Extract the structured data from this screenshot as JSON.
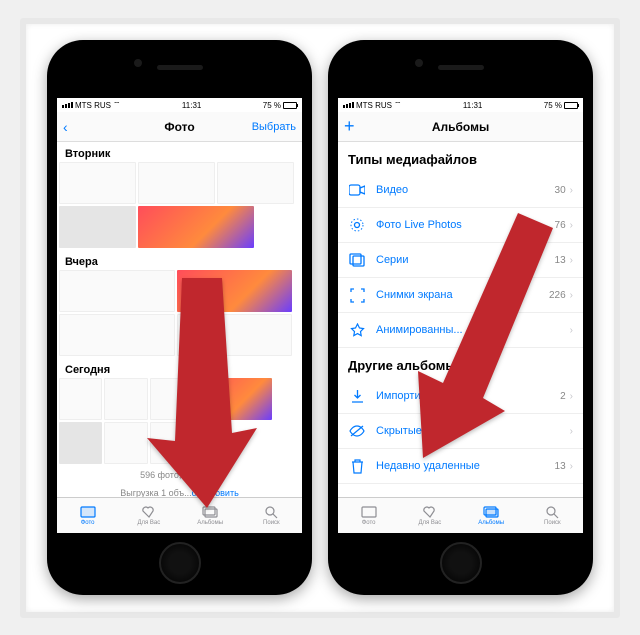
{
  "status": {
    "carrier": "MTS RUS",
    "time": "11:31",
    "battery": "75 %"
  },
  "left": {
    "title": "Фото",
    "select": "Выбрать",
    "sections": [
      "Вторник",
      "Вчера",
      "Сегодня"
    ],
    "summary": "596 фото, ... видео",
    "upload": {
      "prefix": "Выгрузка 1 объ...",
      "action": "остановить"
    },
    "tabs": [
      "Фото",
      "Для Вас",
      "Альбомы",
      "Поиск"
    ],
    "active_tab": 0
  },
  "right": {
    "title": "Альбомы",
    "section_media": "Типы медиафайлов",
    "media": [
      {
        "icon": "video",
        "label": "Видео",
        "count": "30"
      },
      {
        "icon": "live",
        "label": "Фото Live Photos",
        "count": "76"
      },
      {
        "icon": "burst",
        "label": "Серии",
        "count": "13"
      },
      {
        "icon": "screenshot",
        "label": "Снимки экрана",
        "count": "226"
      },
      {
        "icon": "animated",
        "label": "Анимированны...",
        "count": ""
      }
    ],
    "section_other": "Другие альбомы",
    "other": [
      {
        "icon": "import",
        "label": "Импортированные",
        "count": "2"
      },
      {
        "icon": "hidden",
        "label": "Скрытые",
        "count": ""
      },
      {
        "icon": "trash",
        "label": "Недавно удаленные",
        "count": "13"
      }
    ],
    "tabs": [
      "Фото",
      "Для Вас",
      "Альбомы",
      "Поиск"
    ],
    "active_tab": 2
  },
  "colors": {
    "accent": "#007aff",
    "arrow": "#c0272d"
  }
}
